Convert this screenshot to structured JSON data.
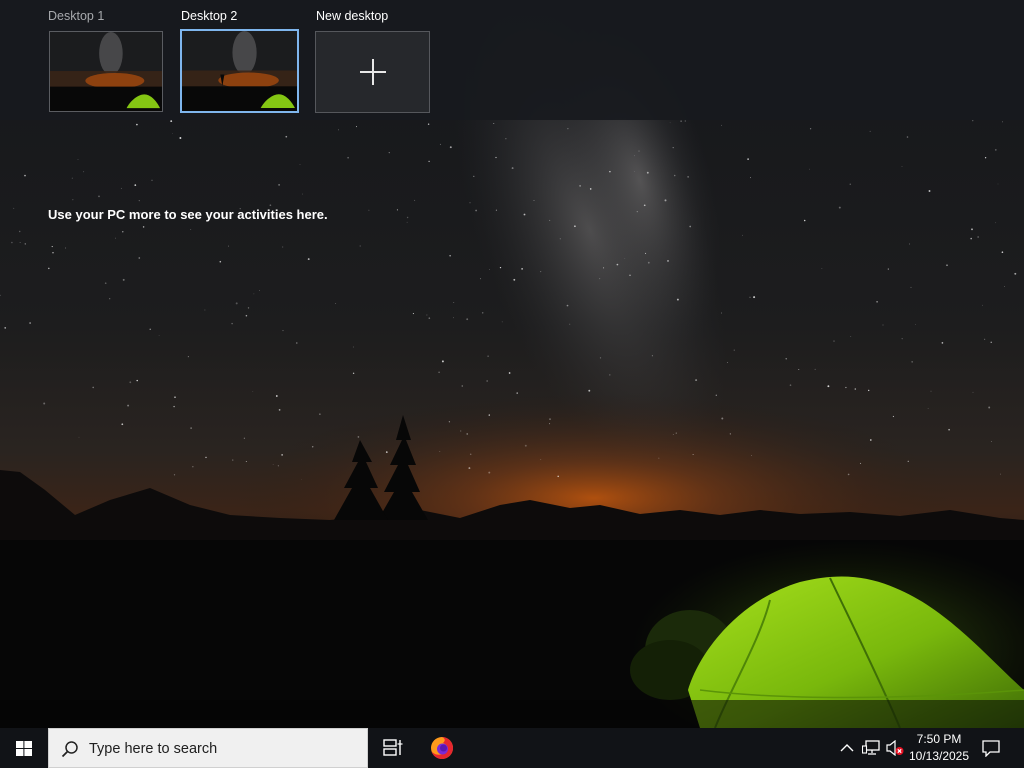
{
  "desktops": [
    {
      "label": "Desktop 1",
      "active": false
    },
    {
      "label": "Desktop 2",
      "active": true
    }
  ],
  "new_desktop": {
    "label": "New desktop",
    "icon": "plus-icon"
  },
  "activity": {
    "message": "Use your PC more to see your activities here."
  },
  "taskbar": {
    "start_icon": "windows-logo-icon",
    "search": {
      "placeholder": "Type here to search",
      "icon": "search-icon"
    },
    "taskview_icon": "task-view-icon",
    "pinned": [
      {
        "name": "Firefox",
        "icon": "firefox-icon"
      }
    ],
    "tray": {
      "chevron_icon": "chevron-up-icon",
      "network_icon": "network-icon",
      "volume_icon": "volume-muted-icon",
      "time": "7:50 PM",
      "date": "10/13/2025",
      "notification_icon": "action-center-icon"
    }
  },
  "colors": {
    "accent_border": "#7fb6ee",
    "taskbar_bg": "#111317",
    "tent_green": "#8fd10f"
  }
}
